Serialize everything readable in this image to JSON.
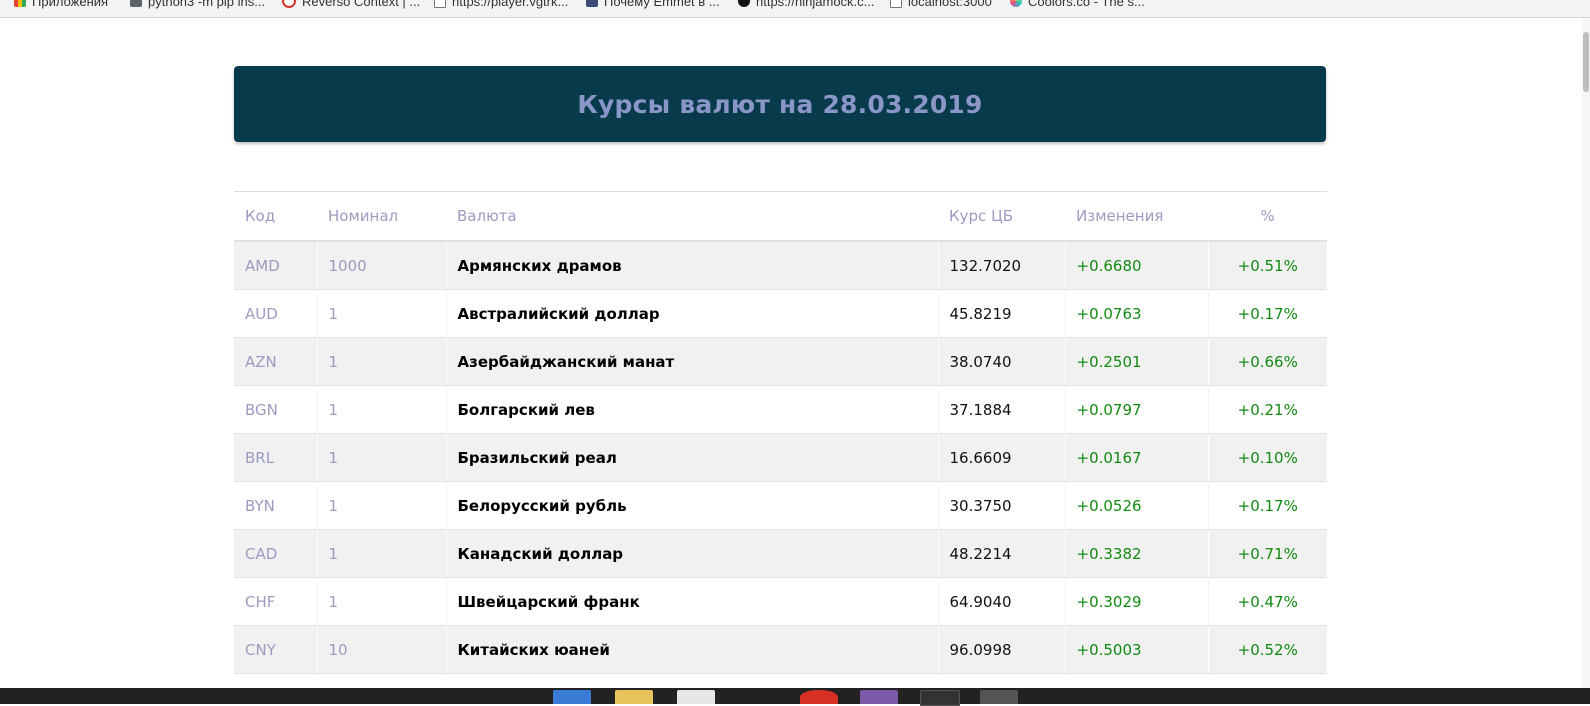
{
  "bookmarks": [
    {
      "label": "Приложения",
      "icon": "apps-icon"
    },
    {
      "label": "python3 -m pip ins...",
      "icon": "folder-icon"
    },
    {
      "label": "Reverso Context | ...",
      "icon": "reverso-icon"
    },
    {
      "label": "https://player.vgtrk...",
      "icon": "page-icon"
    },
    {
      "label": "Почему Emmet в ...",
      "icon": "facebook-icon"
    },
    {
      "label": "https://ninjamock.c...",
      "icon": "ninjamock-icon"
    },
    {
      "label": "localhost:3000",
      "icon": "page-icon"
    },
    {
      "label": "Coolors.co - The s...",
      "icon": "coolors-icon"
    }
  ],
  "header": {
    "title": "Курсы валют на 28.03.2019"
  },
  "table": {
    "columns": {
      "code": "Код",
      "nominal": "Номинал",
      "currency": "Валюта",
      "rate": "Курс ЦБ",
      "change": "Изменения",
      "percent": "%"
    },
    "rows": [
      {
        "code": "AMD",
        "nominal": "1000",
        "name": "Армянских драмов",
        "rate": "132.7020",
        "change": "+0.6680",
        "percent": "+0.51%"
      },
      {
        "code": "AUD",
        "nominal": "1",
        "name": "Австралийский доллар",
        "rate": "45.8219",
        "change": "+0.0763",
        "percent": "+0.17%"
      },
      {
        "code": "AZN",
        "nominal": "1",
        "name": "Азербайджанский манат",
        "rate": "38.0740",
        "change": "+0.2501",
        "percent": "+0.66%"
      },
      {
        "code": "BGN",
        "nominal": "1",
        "name": "Болгарский лев",
        "rate": "37.1884",
        "change": "+0.0797",
        "percent": "+0.21%"
      },
      {
        "code": "BRL",
        "nominal": "1",
        "name": "Бразильский реал",
        "rate": "16.6609",
        "change": "+0.0167",
        "percent": "+0.10%"
      },
      {
        "code": "BYN",
        "nominal": "1",
        "name": "Белорусский рубль",
        "rate": "30.3750",
        "change": "+0.0526",
        "percent": "+0.17%"
      },
      {
        "code": "CAD",
        "nominal": "1",
        "name": "Канадский доллар",
        "rate": "48.2214",
        "change": "+0.3382",
        "percent": "+0.71%"
      },
      {
        "code": "CHF",
        "nominal": "1",
        "name": "Швейцарский франк",
        "rate": "64.9040",
        "change": "+0.3029",
        "percent": "+0.47%"
      },
      {
        "code": "CNY",
        "nominal": "10",
        "name": "Китайских юаней",
        "rate": "96.0998",
        "change": "+0.5003",
        "percent": "+0.52%"
      }
    ]
  },
  "colors": {
    "header_bg": "#073b4c",
    "header_text": "#8b96c8",
    "muted_text": "#9a9cc0",
    "positive": "#128a12"
  }
}
